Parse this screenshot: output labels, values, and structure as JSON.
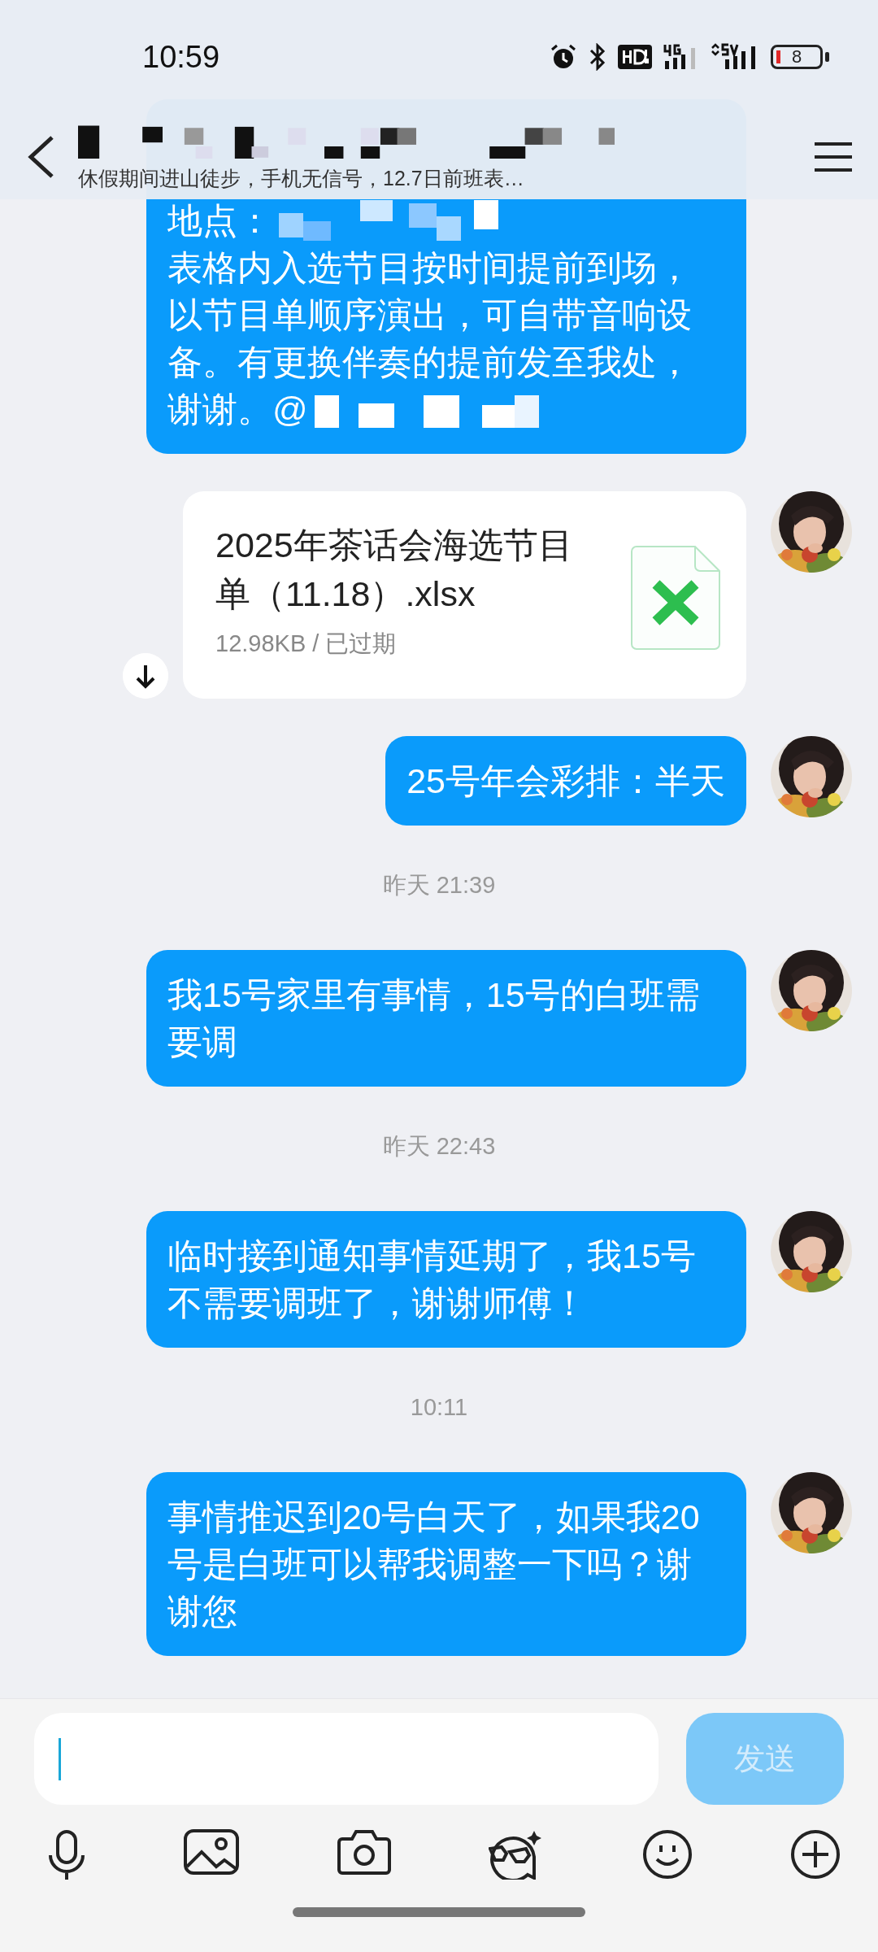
{
  "status_bar": {
    "time": "10:59",
    "battery": "8"
  },
  "header": {
    "subtitle": "休假期间进山徒步，手机无信号，12.7日前班表…"
  },
  "messages": [
    {
      "kind": "text",
      "text": "地点：",
      "text_2": "表格内入选节目按时间提前到场，以节目单顺序演出，可自带音响设备。有更换伴奏的提前发至我处，谢谢。@",
      "mosaic": true
    },
    {
      "kind": "file",
      "name": "2025年茶话会海选节目单（11.18）.xlsx",
      "meta": "12.98KB / 已过期"
    },
    {
      "kind": "text",
      "text": "25号年会彩排：半天",
      "mosaic": false
    },
    {
      "kind": "time",
      "text": "昨天 21:39"
    },
    {
      "kind": "text",
      "text": "我15号家里有事情，15号的白班需要调",
      "mosaic": false
    },
    {
      "kind": "time",
      "text": "昨天 22:43"
    },
    {
      "kind": "text",
      "text": "临时接到通知事情延期了，我15号不需要调班了，谢谢师傅！",
      "mosaic": false
    },
    {
      "kind": "time",
      "text": "10:11"
    },
    {
      "kind": "text",
      "text": "事情推迟到20号白天了，如果我20号是白班可以帮我调整一下吗？谢谢您",
      "mosaic": false
    }
  ],
  "composer": {
    "send": "发送",
    "send_disabled": true
  }
}
